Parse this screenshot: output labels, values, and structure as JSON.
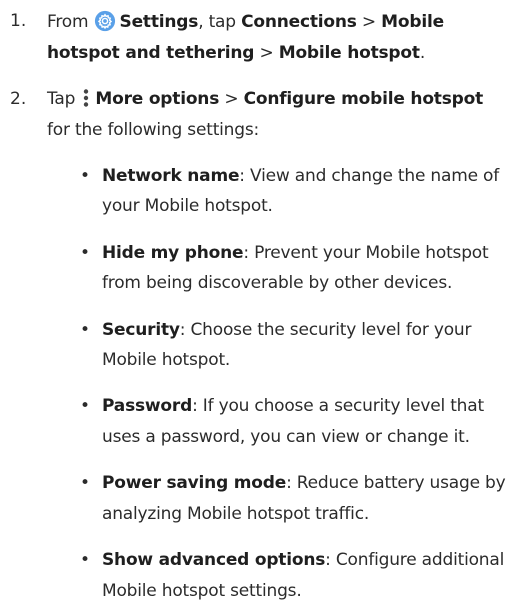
{
  "steps": [
    {
      "number": "1.",
      "lines": [
        {
          "pre": "From ",
          "b1": "Settings",
          "t1": ", tap ",
          "b2": "Connections",
          "t2": " > ",
          "b3": "Mobile"
        },
        {
          "b1": "hotspot and tethering",
          "t1": " > ",
          "b2": "Mobile hotspot",
          "t2": "."
        }
      ]
    },
    {
      "number": "2.",
      "lines": [
        {
          "pre": "Tap ",
          "b1": "More options",
          "t1": " > ",
          "b2": "Configure mobile hotspot"
        },
        {
          "t1": "for the following settings:"
        }
      ]
    }
  ],
  "bullet_char": "•",
  "items": [
    {
      "term": "Network name",
      "l1": ": View and change the name of",
      "l2": "your Mobile hotspot."
    },
    {
      "term": "Hide my phone",
      "l1": ": Prevent your Mobile hotspot",
      "l2": "from being discoverable by other devices."
    },
    {
      "term": "Security",
      "l1": ": Choose the security level for your",
      "l2": "Mobile hotspot."
    },
    {
      "term": "Password",
      "l1": ": If you choose a security level that",
      "l2": "uses a password, you can view or change it."
    },
    {
      "term": "Power saving mode",
      "l1": ": Reduce battery usage by",
      "l2": "analyzing Mobile hotspot traffic."
    },
    {
      "term": "Show advanced options",
      "l1": ": Configure additional",
      "l2": "Mobile hotspot settings."
    }
  ],
  "colors": {
    "settings_icon": "#5aa0e8",
    "text": "#2b2b2b"
  },
  "icons": {
    "settings": "gear-icon",
    "more_options": "more-options-icon"
  }
}
